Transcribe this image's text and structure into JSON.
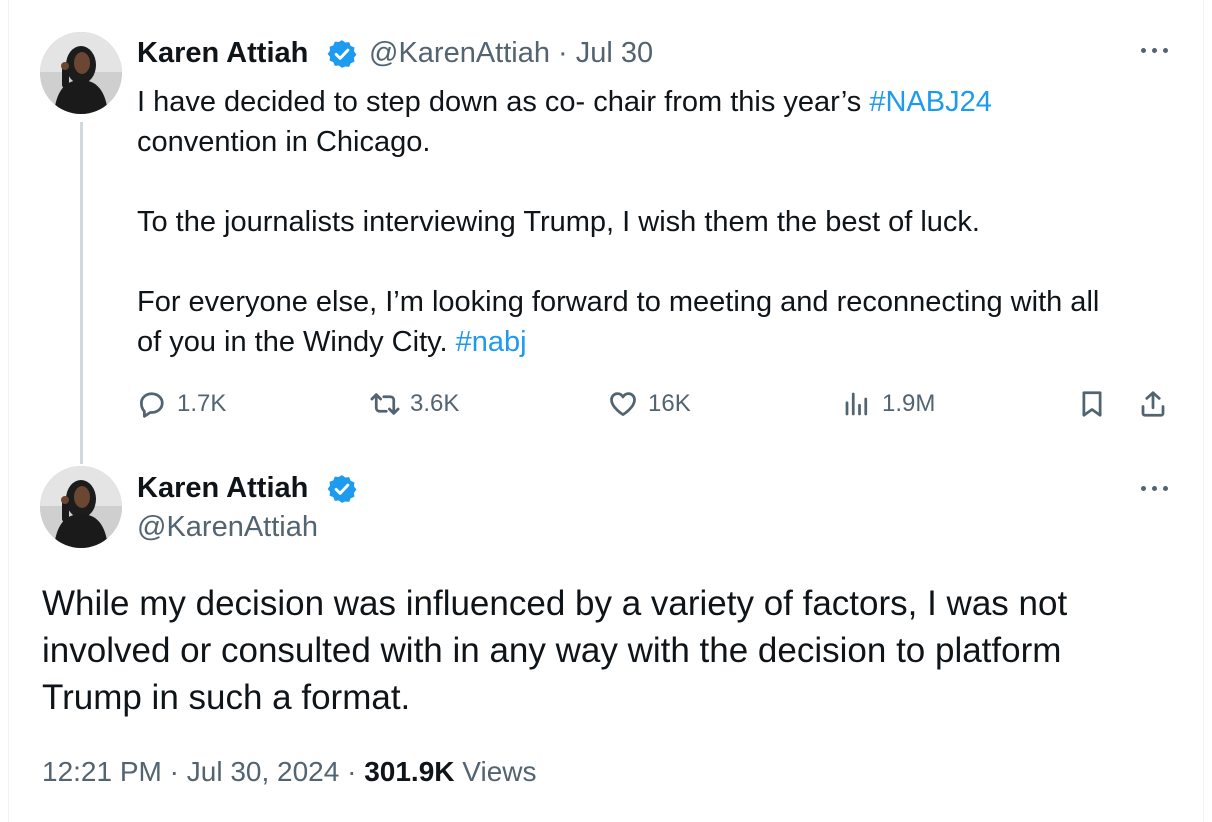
{
  "tweet1": {
    "author_name": "Karen Attiah",
    "handle": "@KarenAttiah",
    "separator": "·",
    "date": "Jul 30",
    "text_line1_pre": "I have decided to step down as co- chair from this year’s ",
    "hashtag1": "#NABJ24",
    "text_line2": "convention in Chicago.",
    "para2": "To the journalists interviewing Trump, I wish them the best of luck.",
    "para3_line1": "For everyone else, I’m looking forward to meeting and reconnecting with all",
    "para3_line2_pre": "of you in the Windy City. ",
    "hashtag2": "#nabj",
    "replies": "1.7K",
    "reposts": "3.6K",
    "likes": "16K",
    "views": "1.9M"
  },
  "tweet2": {
    "author_name": "Karen Attiah",
    "handle": "@KarenAttiah",
    "text_line1": "While my decision was influenced by a variety of factors, I was not",
    "text_line2": "involved or consulted with in any way with the decision to platform",
    "text_line3": "Trump in such a format.",
    "time": "12:21 PM",
    "meta_sep1": "·",
    "date": "Jul 30, 2024",
    "meta_sep2": "·",
    "views_count": "301.9K",
    "views_label": "Views"
  },
  "icons": {
    "verified": "verified-badge-icon",
    "more": "more-horizontal-icon",
    "reply": "reply-icon",
    "repost": "repost-icon",
    "like": "heart-icon",
    "views": "views-bar-chart-icon",
    "bookmark": "bookmark-icon",
    "share": "share-icon"
  },
  "colors": {
    "link": "#1d9bf0",
    "secondary_text": "#536471",
    "primary_text": "#0f1419",
    "thread_line": "#cfd9de",
    "verified": "#1d9bf0"
  }
}
